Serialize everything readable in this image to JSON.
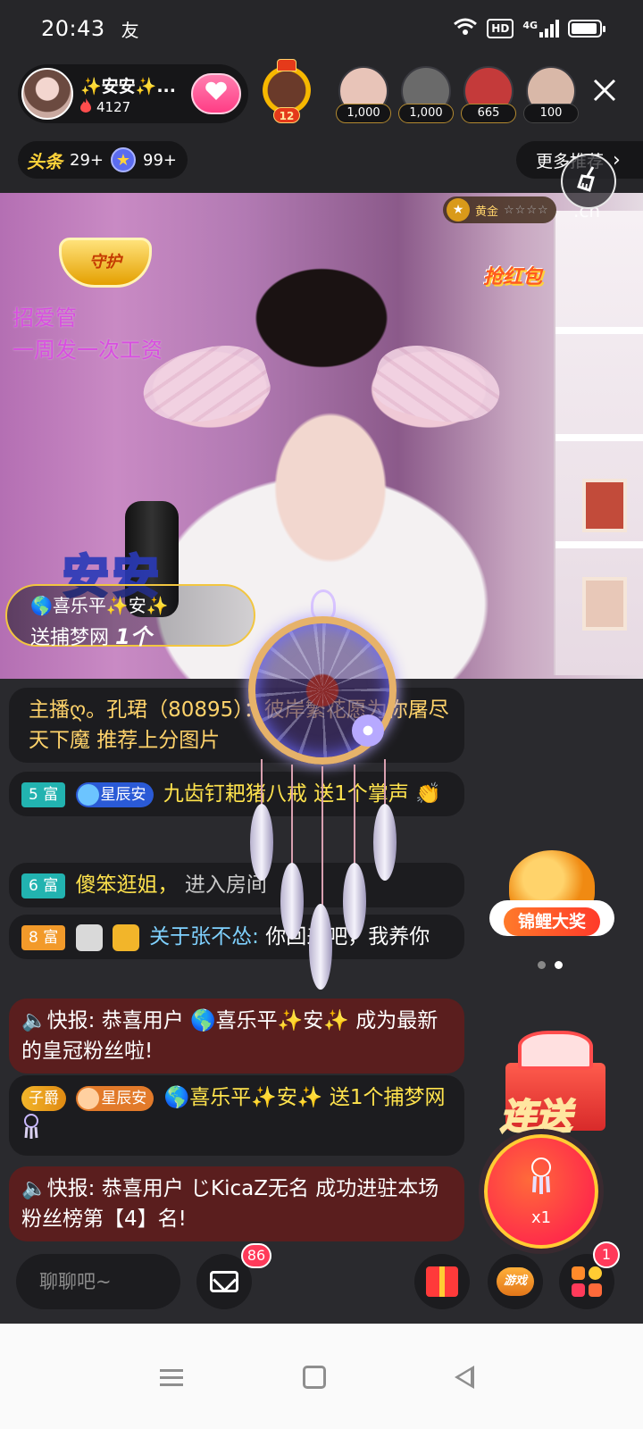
{
  "status_bar": {
    "time": "20:43",
    "notification_icon": "友",
    "hd_label": "HD",
    "network_label": "4G"
  },
  "header": {
    "host_name": "✨安安✨...",
    "host_heat": "4127",
    "follow_icon": "heart-icon",
    "crown_level": "12",
    "viewers": [
      {
        "count": "1,000",
        "color": "#e8c4b8"
      },
      {
        "count": "1,000",
        "color": "#6a6a6a"
      },
      {
        "count": "665",
        "color": "#c43a3a"
      },
      {
        "count": "100",
        "color": "#d9b8a8"
      }
    ],
    "close_icon": "close-icon"
  },
  "sub_row": {
    "toutiao_label": "头条",
    "toutiao_count": "29+",
    "star_count": "99+",
    "more_label": "更多推荐",
    "clean_icon": "broom-icon"
  },
  "video": {
    "guard_logo": "守护",
    "ad_line1": "招爱管",
    "ad_line2": "一周发一次工资",
    "hongbao_label": "抢红包",
    "gold_label": "黄金",
    "gold_stars": "☆☆☆☆",
    "domain_text": ".cn",
    "anan_watermark": "安安",
    "banner_user": "🌎喜乐平✨安✨",
    "banner_action": "送捕梦网",
    "banner_count": "1个"
  },
  "chat": {
    "messages": [
      {
        "text": "主播ღ。孔珺（80895）：彼岸繁花愿为你屠尽天下魔 推荐上分图片"
      },
      {
        "badge": "5 富",
        "fan_badge": "星辰安",
        "user": "九齿钉耙猪八戒",
        "action": "送1个掌声",
        "emoji": "👏"
      },
      {
        "badge": "6 富",
        "user": "傻笨逛姐，",
        "action": "进入房间"
      },
      {
        "badge": "8 富",
        "user": "关于张不怂:",
        "content": "你回来吧，我养你"
      },
      {
        "prefix": "🔈快报:",
        "text": "恭喜用户 🌎喜乐平✨安✨ 成为最新的皇冠粉丝啦!"
      },
      {
        "badge": "子爵",
        "fan_badge": "星辰安",
        "user": "🌎喜乐平✨安✨",
        "action": "送1个捕梦网"
      },
      {
        "prefix": "🔈快报:",
        "text": "恭喜用户 じKicaZ无名 成功进驻本场粉丝榜第【4】名!"
      }
    ]
  },
  "side": {
    "koi_label": "锦鲤大奖",
    "combo_label": "连送",
    "combo_count": "x1"
  },
  "bottom_bar": {
    "chat_placeholder": "聊聊吧~",
    "mail_badge": "86",
    "game_label": "游戏",
    "more_badge": "1"
  }
}
